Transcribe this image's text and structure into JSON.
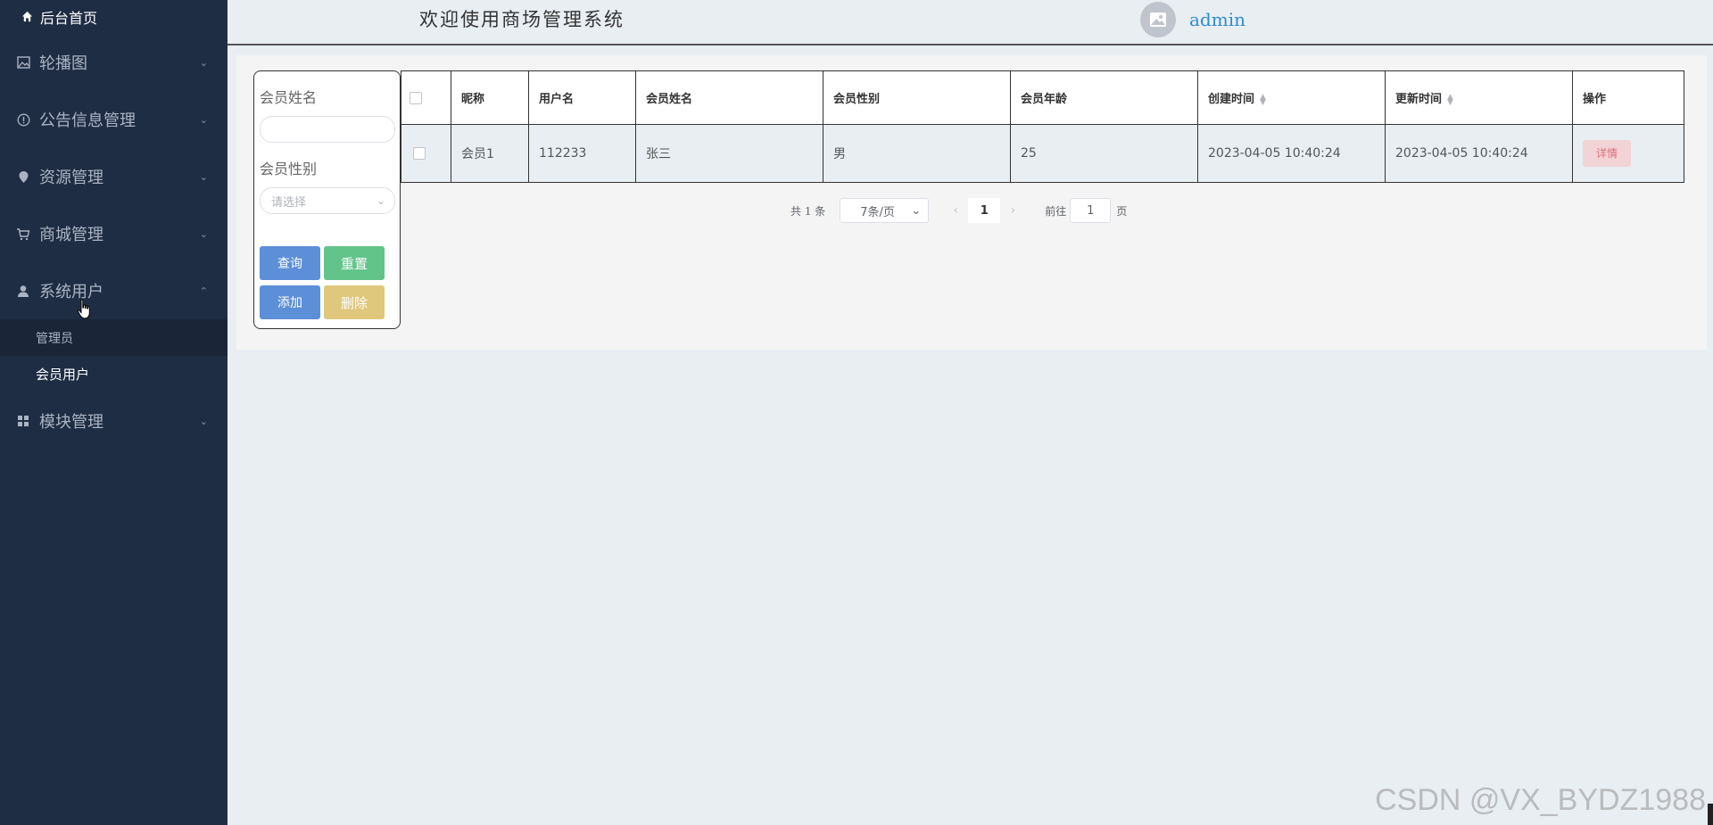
{
  "sidebar": {
    "home_label": "后台首页",
    "menus": [
      {
        "label": "轮播图",
        "icon": "image-icon"
      },
      {
        "label": "公告信息管理",
        "icon": "info-icon"
      },
      {
        "label": "资源管理",
        "icon": "location-pin-icon"
      },
      {
        "label": "商城管理",
        "icon": "cart-icon"
      },
      {
        "label": "系统用户",
        "icon": "user-icon",
        "expanded": true
      },
      {
        "label": "模块管理",
        "icon": "grid-icon"
      }
    ],
    "sub_items": [
      "管理员",
      "会员用户"
    ],
    "active_sub_item": "会员用户"
  },
  "header": {
    "title": "欢迎使用商场管理系统",
    "username": "admin"
  },
  "search": {
    "name_label": "会员姓名",
    "name_value": "",
    "gender_label": "会员性别",
    "gender_placeholder": "请选择",
    "query_label": "查询",
    "reset_label": "重置",
    "add_label": "添加",
    "delete_label": "删除"
  },
  "table": {
    "headers": [
      "昵称",
      "用户名",
      "会员姓名",
      "会员性别",
      "会员年龄",
      "创建时间",
      "更新时间",
      "操作"
    ],
    "rows": [
      {
        "nickname": "会员1",
        "username": "112233",
        "name": "张三",
        "gender": "男",
        "age": "25",
        "created": "2023-04-05 10:40:24",
        "updated": "2023-04-05 10:40:24",
        "action": "详情"
      }
    ]
  },
  "pagination": {
    "total_text": "共 1 条",
    "page_size": "7条/页",
    "current_page": "1",
    "goto_label": "前往",
    "goto_value": "1",
    "goto_unit": "页"
  },
  "watermark": "CSDN @VX_BYDZ1988",
  "colors": {
    "sidebar_bg": "#1f2d44",
    "primary": "#5c8fd8",
    "success": "#63c48a",
    "warning": "#dfc77c",
    "danger_light": "#f2d3d6",
    "link": "#2d8ccf"
  }
}
